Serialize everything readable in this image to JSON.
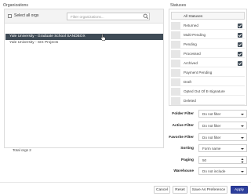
{
  "organizations": {
    "title": "Organizations",
    "select_all_label": "Select all orgs",
    "filter_placeholder": "Filter organizations...",
    "items": [
      {
        "label": "Yale University - Graduate School SANDBOX",
        "selected": true
      },
      {
        "label": "Yale University - SIS Projects",
        "selected": false
      }
    ],
    "total_label": "Total orgs 2"
  },
  "statuses": {
    "title": "Statuses",
    "all_label": "All Statuses",
    "items": [
      {
        "label": "Returned",
        "checked": true
      },
      {
        "label": "Multi-Pending",
        "checked": true
      },
      {
        "label": "Pending",
        "checked": true
      },
      {
        "label": "Processed",
        "checked": true
      },
      {
        "label": "Archived",
        "checked": true
      },
      {
        "label": "Payment Pending",
        "checked": false
      },
      {
        "label": "Draft",
        "checked": false
      },
      {
        "label": "Opted Out Of E-Signature",
        "checked": false
      },
      {
        "label": "Deleted",
        "checked": false
      }
    ]
  },
  "filters": {
    "folder": {
      "label": "Folder Filter",
      "value": "Do not filter"
    },
    "active": {
      "label": "Active Filter",
      "value": "Do not filter"
    },
    "favorite": {
      "label": "Favorite Filter",
      "value": "Do not filter"
    },
    "sorting": {
      "label": "Sorting",
      "value": "Form name"
    },
    "paging": {
      "label": "Paging",
      "value": "50"
    },
    "warehouse": {
      "label": "Warehouse",
      "value": "Do not include"
    }
  },
  "buttons": {
    "cancel": "Cancel",
    "reset": "Reset",
    "save_pref": "Save As Preference",
    "apply": "Apply"
  },
  "colors": {
    "accent": "#2c3e9c",
    "selected_row": "#3f4b56"
  }
}
